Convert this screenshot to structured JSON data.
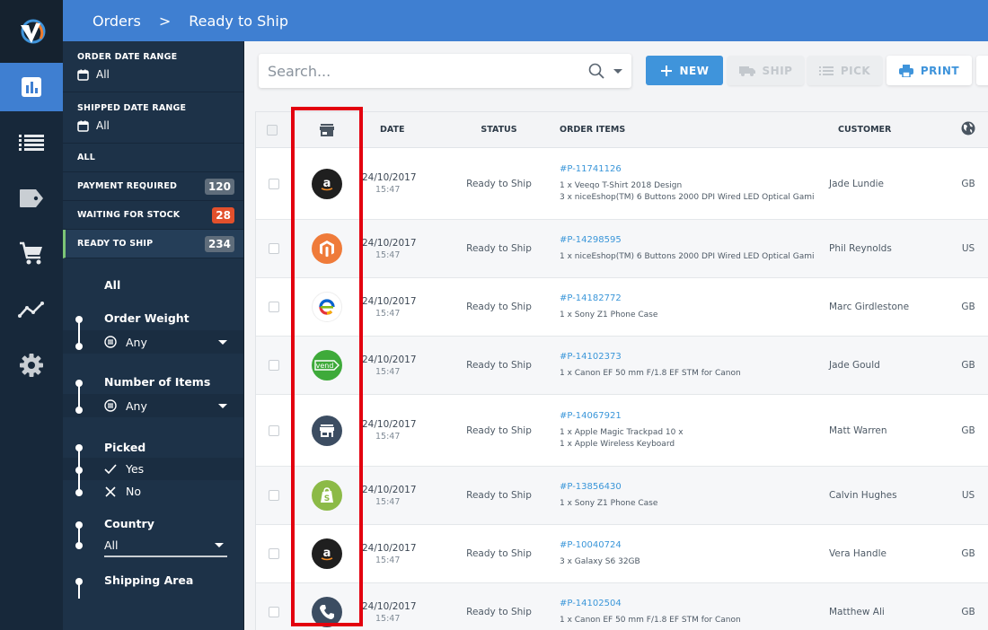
{
  "breadcrumb": {
    "root": "Orders",
    "separator": ">",
    "current": "Ready to Ship"
  },
  "rail": {
    "items": [
      {
        "name": "dashboard",
        "active": true
      },
      {
        "name": "orders-list",
        "active": false
      },
      {
        "name": "products",
        "active": false
      },
      {
        "name": "purchasing",
        "active": false
      },
      {
        "name": "reports",
        "active": false
      },
      {
        "name": "settings",
        "active": false
      }
    ]
  },
  "filters": {
    "order_date": {
      "label": "ORDER DATE RANGE",
      "value": "All"
    },
    "shipped_date": {
      "label": "SHIPPED DATE RANGE",
      "value": "All"
    },
    "statuses": [
      {
        "label": "ALL",
        "count": null
      },
      {
        "label": "PAYMENT REQUIRED",
        "count": "120"
      },
      {
        "label": "WAITING FOR STOCK",
        "count": "28"
      },
      {
        "label": "READY TO SHIP",
        "count": "234"
      }
    ],
    "all_label": "All",
    "order_weight": {
      "title": "Order Weight",
      "value": "Any"
    },
    "number_of_items": {
      "title": "Number of Items",
      "value": "Any"
    },
    "picked": {
      "title": "Picked",
      "yes": "Yes",
      "no": "No",
      "selected": "Yes"
    },
    "country": {
      "title": "Country",
      "value": "All"
    },
    "shipping_area": {
      "title": "Shipping Area"
    }
  },
  "toolbar": {
    "search_placeholder": "Search...",
    "new_label": "NEW",
    "ship_label": "SHIP",
    "pick_label": "PICK",
    "print_label": "PRINT"
  },
  "table": {
    "headers": {
      "date": "DATE",
      "status": "STATUS",
      "items": "ORDER ITEMS",
      "customer": "CUSTOMER"
    },
    "rows": [
      {
        "channel": "amazon",
        "date": "24/10/2017",
        "time": "15:47",
        "status": "Ready to Ship",
        "id": "#P-11741126",
        "items": [
          "1 x Veeqo T-Shirt 2018 Design",
          "3 x niceEshop(TM) 6 Buttons 2000 DPI Wired LED Optical Gami"
        ],
        "customer": "Jade Lundie",
        "country": "GB"
      },
      {
        "channel": "magento",
        "date": "24/10/2017",
        "time": "15:47",
        "status": "Ready to Ship",
        "id": "#P-14298595",
        "items": [
          "1 x niceEshop(TM) 6 Buttons 2000 DPI Wired LED Optical Gami"
        ],
        "customer": "Phil Reynolds",
        "country": "US"
      },
      {
        "channel": "ebay",
        "date": "24/10/2017",
        "time": "15:47",
        "status": "Ready to Ship",
        "id": "#P-14182772",
        "items": [
          "1 x Sony Z1 Phone Case"
        ],
        "customer": "Marc Girdlestone",
        "country": "GB"
      },
      {
        "channel": "vend",
        "date": "24/10/2017",
        "time": "15:47",
        "status": "Ready to Ship",
        "id": "#P-14102373",
        "items": [
          "1 x Canon EF 50 mm F/1.8 EF STM for Canon"
        ],
        "customer": "Jade Gould",
        "country": "GB"
      },
      {
        "channel": "store",
        "date": "24/10/2017",
        "time": "15:47",
        "status": "Ready to Ship",
        "id": "#P-14067921",
        "items": [
          "1 x Apple Magic Trackpad 10 x",
          "1 x Apple Wireless Keyboard"
        ],
        "customer": "Matt Warren",
        "country": "GB"
      },
      {
        "channel": "shopify",
        "date": "24/10/2017",
        "time": "15:47",
        "status": "Ready to Ship",
        "id": "#P-13856430",
        "items": [
          "1 x Sony Z1 Phone Case"
        ],
        "customer": "Calvin Hughes",
        "country": "US"
      },
      {
        "channel": "amazon",
        "date": "24/10/2017",
        "time": "15:47",
        "status": "Ready to Ship",
        "id": "#P-10040724",
        "items": [
          "3 x Galaxy S6 32GB"
        ],
        "customer": "Vera Handle",
        "country": "GB"
      },
      {
        "channel": "phone",
        "date": "24/10/2017",
        "time": "15:47",
        "status": "Ready to Ship",
        "id": "#P-14102504",
        "items": [
          "1 x Canon EF 50 mm F/1.8 EF STM for Canon"
        ],
        "customer": "Matthew Ali",
        "country": "GB"
      }
    ]
  },
  "colors": {
    "accent": "#3f7fd1",
    "link": "#3a96d9",
    "highlight": "#e3000f",
    "alert": "#e2502c",
    "active_marker": "#7cc576"
  }
}
